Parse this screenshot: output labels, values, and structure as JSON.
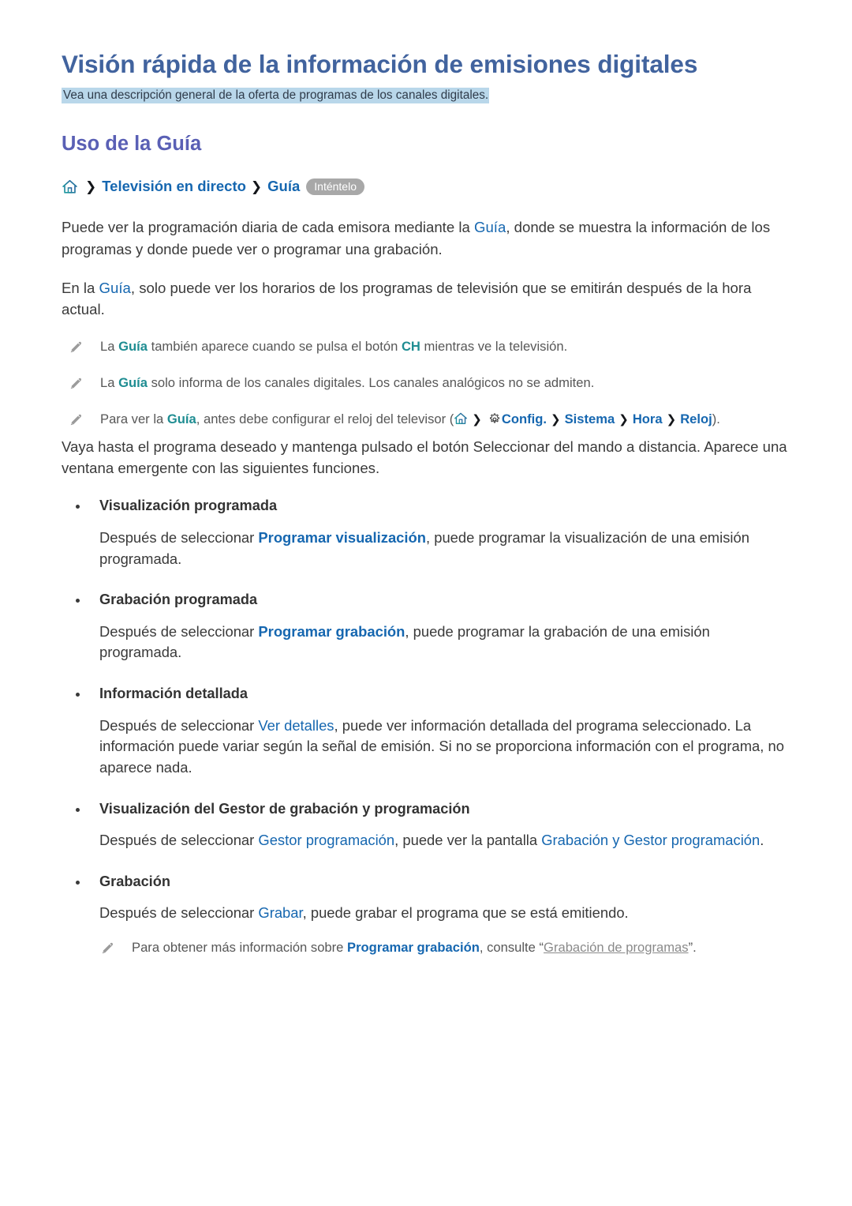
{
  "document": {
    "title": "Visión rápida de la información de emisiones digitales",
    "subtitle": "Vea una descripción general de la oferta de programas de los canales digitales.",
    "section_heading": "Uso de la Guía"
  },
  "colors": {
    "title": "#41639e",
    "section_heading": "#5a60b5",
    "highlight_band": "#b9d7ea",
    "link_blue": "#1667b0",
    "accent_teal": "#1f8d92",
    "badge_gray": "#a8a8a8",
    "body_text": "#3a3a3a"
  },
  "breadcrumb": {
    "home_icon": "home-icon",
    "separator": "❯",
    "items": [
      {
        "label": "Televisión en directo"
      },
      {
        "label": "Guía"
      }
    ],
    "badge": "Inténtelo"
  },
  "intro": {
    "p1_a": "Puede ver la programación diaria de cada emisora mediante la ",
    "p1_link": "Guía",
    "p1_b": ", donde se muestra la información de los programas y donde puede ver o programar una grabación.",
    "p2_a": "En la ",
    "p2_link": "Guía",
    "p2_b": ", solo puede ver los horarios de los programas de televisión que se emitirán después de la hora actual."
  },
  "notes": [
    {
      "icon": "pencil-icon",
      "a": "La ",
      "k1": "Guía",
      "b": " también aparece cuando se pulsa el botón ",
      "k2": "CH",
      "c": " mientras ve la televisión."
    },
    {
      "icon": "pencil-icon",
      "a": "La ",
      "k1": "Guía",
      "b": " solo informa de los canales digitales. Los canales analógicos no se admiten.",
      "k2": "",
      "c": ""
    }
  ],
  "note_path": {
    "icon": "pencil-icon",
    "a": "Para ver la ",
    "k1": "Guía",
    "b": ", antes debe configurar el reloj del televisor (",
    "home_icon": "home-icon",
    "gear_icon": "gear-icon",
    "path": [
      "Config.",
      "Sistema",
      "Hora",
      "Reloj"
    ],
    "separator": "❯",
    "c": ")."
  },
  "middle_paragraph": "Vaya hasta el programa deseado y mantenga pulsado el botón Seleccionar del mando a distancia. Aparece una ventana emergente con las siguientes funciones.",
  "bullets": [
    {
      "title": "Visualización programada",
      "body_a": "Después de seleccionar ",
      "link1": "Programar visualización",
      "body_b": ", puede programar la visualización de una emisión programada.",
      "link2": "",
      "body_c": ""
    },
    {
      "title": "Grabación programada",
      "body_a": "Después de seleccionar ",
      "link1": "Programar grabación",
      "body_b": ", puede programar la grabación de una emisión programada.",
      "link2": "",
      "body_c": ""
    },
    {
      "title": "Información detallada",
      "body_a": "Después de seleccionar ",
      "link1": "Ver detalles",
      "body_b": ", puede ver información detallada del programa seleccionado. La información puede variar según la señal de emisión. Si no se proporciona información con el programa, no aparece nada.",
      "link2": "",
      "body_c": ""
    },
    {
      "title": "Visualización del Gestor de grabación y programación",
      "body_a": "Después de seleccionar ",
      "link1": "Gestor programación",
      "body_b": ", puede ver la pantalla ",
      "link2": "Grabación y Gestor programación",
      "body_c": "."
    },
    {
      "title": "Grabación",
      "body_a": "Después de seleccionar ",
      "link1": "Grabar",
      "body_b": ", puede grabar el programa que se está emitiendo.",
      "link2": "",
      "body_c": ""
    }
  ],
  "final_note": {
    "icon": "pencil-icon",
    "a": "Para obtener más información sobre ",
    "k1": "Programar grabación",
    "b": ", consulte “",
    "k2": "Grabación de programas",
    "c": "”."
  }
}
